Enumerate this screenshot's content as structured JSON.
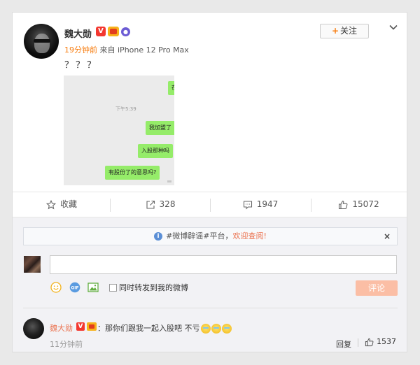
{
  "post": {
    "username": "魏大勋",
    "verified_badge": "V",
    "follow_label": "关注",
    "follow_prefix": "+",
    "relative_time": "19分钟前",
    "source_prefix": "来自",
    "source_device": "iPhone 12 Pro Max",
    "text": "？？？",
    "image": {
      "timestamp": "下午5:39",
      "bubbles": [
        "我加盟了",
        "入股那种吗",
        "有股份了的意思吗?",
        "在"
      ]
    }
  },
  "actions": {
    "collect_label": "收藏",
    "forward_count": "328",
    "comment_count": "1947",
    "like_count": "15072"
  },
  "comment_box": {
    "notice_text": "#微博辟谣#平台，",
    "notice_link": "欢迎查阅!",
    "notice_close": "×",
    "input_value": "",
    "also_forward_label": "同时转发到我的微博",
    "submit_label": "评论"
  },
  "comments": [
    {
      "username": "魏大勋",
      "verified_badge": "V",
      "text": "：那你们跟我一起入股吧 不亏",
      "time": "11分钟前",
      "reply_label": "回复",
      "like_count": "1537"
    }
  ],
  "colors": {
    "accent_orange": "#f77c0e",
    "name_link": "#eb7350",
    "verified_red": "#f3372f",
    "bubble_green": "#95ec69",
    "submit_disabled": "#fbbea5"
  },
  "icons": [
    "chevron-down-icon",
    "star-icon",
    "share-icon",
    "comment-icon",
    "thumbs-up-icon",
    "info-icon",
    "smiley-icon",
    "gif-icon",
    "image-icon"
  ]
}
